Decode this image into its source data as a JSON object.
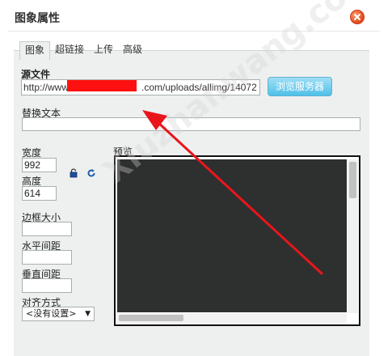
{
  "dialog": {
    "title": "图象属性"
  },
  "tabs": [
    {
      "label": "图象",
      "active": true
    },
    {
      "label": "超链接",
      "active": false
    },
    {
      "label": "上传",
      "active": false
    },
    {
      "label": "高级",
      "active": false
    }
  ],
  "image_tab": {
    "source_label": "源文件",
    "url_prefix": "http://www",
    "url_suffix": ".com/uploads/allimg/14072",
    "browse_label": "浏览服务器",
    "alt_label": "替换文本",
    "alt_value": "",
    "width_label": "宽度",
    "width_value": "992",
    "height_label": "高度",
    "height_value": "614",
    "border_label": "边框大小",
    "border_value": "",
    "hspace_label": "水平间距",
    "hspace_value": "",
    "vspace_label": "垂直间距",
    "vspace_value": "",
    "align_label": "对齐方式",
    "align_value": "<没有设置>",
    "preview_label": "预览"
  },
  "icons": {
    "close": "close-icon",
    "lock": "lock-icon",
    "reset": "reset-size-icon",
    "annotation": "red-arrow-annotation"
  },
  "colors": {
    "close_button": "#e2471b",
    "browse_button": "#4fc0e8",
    "annotation_arrow": "#e8161b",
    "redaction": "#ff1010",
    "panel_bg": "#eef0f0",
    "preview_bg": "#2e2f2f"
  },
  "watermark": "Xiuzhanwang.com"
}
